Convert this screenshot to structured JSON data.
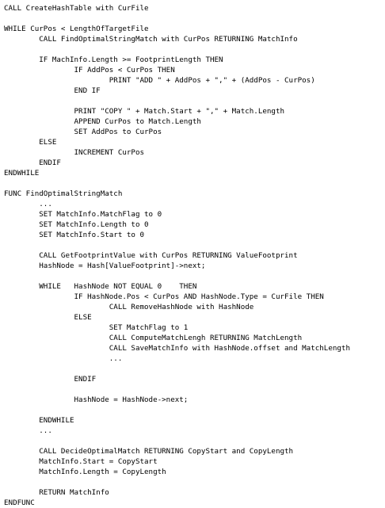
{
  "lines": [
    "CALL CreateHashTable with CurFile",
    "",
    "WHILE CurPos < LengthOfTargetFile",
    "        CALL FindOptimalStringMatch with CurPos RETURNING MatchInfo",
    "",
    "        IF MachInfo.Length >= FootprintLength THEN",
    "                IF AddPos < CurPos THEN",
    "                        PRINT \"ADD \" + AddPos + \",\" + (AddPos - CurPos)",
    "                END IF",
    "",
    "                PRINT \"COPY \" + Match.Start + \",\" + Match.Length",
    "                APPEND CurPos to Match.Length",
    "                SET AddPos to CurPos",
    "        ELSE",
    "                INCREMENT CurPos",
    "        ENDIF",
    "ENDWHILE",
    "",
    "FUNC FindOptimalStringMatch",
    "        ...",
    "        SET MatchInfo.MatchFlag to 0",
    "        SET MatchInfo.Length to 0",
    "        SET MatchInfo.Start to 0",
    "",
    "        CALL GetFootprintValue with CurPos RETURNING ValueFootprint",
    "        HashNode = Hash[ValueFootprint]->next;",
    "",
    "        WHILE   HashNode NOT EQUAL 0    THEN",
    "                IF HashNode.Pos < CurPos AND HashNode.Type = CurFile THEN",
    "                        CALL RemoveHashNode with HashNode",
    "                ELSE",
    "                        SET MatchFlag to 1",
    "                        CALL ComputeMatchLengh RETURNING MatchLength",
    "                        CALL SaveMatchInfo with HashNode.offset and MatchLength",
    "                        ...",
    "",
    "                ENDIF",
    "",
    "                HashNode = HashNode->next;",
    "",
    "        ENDWHILE",
    "        ...",
    "",
    "        CALL DecideOptimalMatch RETURNING CopyStart and CopyLength",
    "        MatchInfo.Start = CopyStart",
    "        MatchInfo.Length = CopyLength",
    "",
    "        RETURN MatchInfo",
    "ENDFUNC"
  ]
}
